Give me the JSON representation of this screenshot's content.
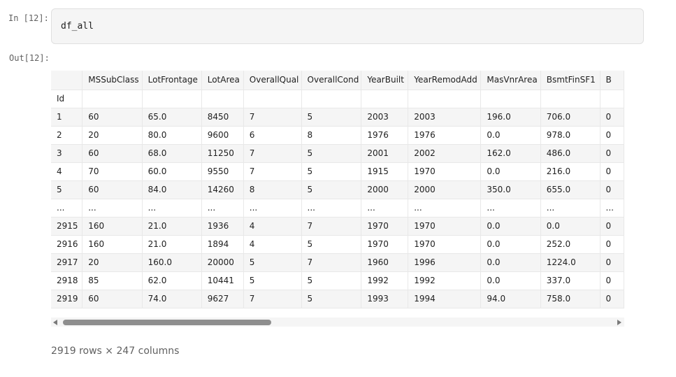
{
  "input_prompt": "In [12]:",
  "output_prompt": "Out[12]:",
  "code": "df_all",
  "dataframe": {
    "index_name": "Id",
    "columns": [
      "MSSubClass",
      "LotFrontage",
      "LotArea",
      "OverallQual",
      "OverallCond",
      "YearBuilt",
      "YearRemodAdd",
      "MasVnrArea",
      "BsmtFinSF1",
      "B"
    ],
    "rows": [
      {
        "index": "1",
        "cells": [
          "60",
          "65.0",
          "8450",
          "7",
          "5",
          "2003",
          "2003",
          "196.0",
          "706.0",
          "0"
        ]
      },
      {
        "index": "2",
        "cells": [
          "20",
          "80.0",
          "9600",
          "6",
          "8",
          "1976",
          "1976",
          "0.0",
          "978.0",
          "0"
        ]
      },
      {
        "index": "3",
        "cells": [
          "60",
          "68.0",
          "11250",
          "7",
          "5",
          "2001",
          "2002",
          "162.0",
          "486.0",
          "0"
        ]
      },
      {
        "index": "4",
        "cells": [
          "70",
          "60.0",
          "9550",
          "7",
          "5",
          "1915",
          "1970",
          "0.0",
          "216.0",
          "0"
        ]
      },
      {
        "index": "5",
        "cells": [
          "60",
          "84.0",
          "14260",
          "8",
          "5",
          "2000",
          "2000",
          "350.0",
          "655.0",
          "0"
        ]
      },
      {
        "index": "...",
        "cells": [
          "...",
          "...",
          "...",
          "...",
          "...",
          "...",
          "...",
          "...",
          "...",
          "..."
        ]
      },
      {
        "index": "2915",
        "cells": [
          "160",
          "21.0",
          "1936",
          "4",
          "7",
          "1970",
          "1970",
          "0.0",
          "0.0",
          "0"
        ]
      },
      {
        "index": "2916",
        "cells": [
          "160",
          "21.0",
          "1894",
          "4",
          "5",
          "1970",
          "1970",
          "0.0",
          "252.0",
          "0"
        ]
      },
      {
        "index": "2917",
        "cells": [
          "20",
          "160.0",
          "20000",
          "5",
          "7",
          "1960",
          "1996",
          "0.0",
          "1224.0",
          "0"
        ]
      },
      {
        "index": "2918",
        "cells": [
          "85",
          "62.0",
          "10441",
          "5",
          "5",
          "1992",
          "1992",
          "0.0",
          "337.0",
          "0"
        ]
      },
      {
        "index": "2919",
        "cells": [
          "60",
          "74.0",
          "9627",
          "7",
          "5",
          "1993",
          "1994",
          "94.0",
          "758.0",
          "0"
        ]
      }
    ]
  },
  "shape_note": "2919 rows × 247 columns",
  "icons": {
    "scroll_left": "scroll-left-arrow-icon",
    "scroll_right": "scroll-right-arrow-icon"
  },
  "colors": {
    "cell_background": "#f5f5f5",
    "scrollbar_thumb": "#8e8e8e"
  }
}
